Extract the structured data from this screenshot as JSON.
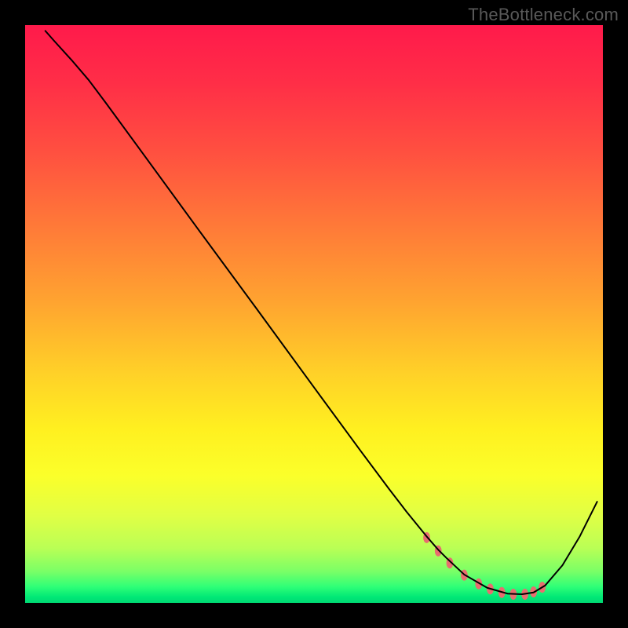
{
  "watermark": "TheBottleneck.com",
  "plot": {
    "inset_left": 32,
    "inset_top": 32,
    "inset_right": 32,
    "inset_bottom": 32,
    "gradient_stops": [
      {
        "pos": 0.0,
        "color": "#ff1a4b"
      },
      {
        "pos": 0.1,
        "color": "#ff2e47"
      },
      {
        "pos": 0.22,
        "color": "#ff5040"
      },
      {
        "pos": 0.35,
        "color": "#ff7a38"
      },
      {
        "pos": 0.48,
        "color": "#ffa430"
      },
      {
        "pos": 0.6,
        "color": "#ffd028"
      },
      {
        "pos": 0.7,
        "color": "#fff020"
      },
      {
        "pos": 0.78,
        "color": "#fbff2a"
      },
      {
        "pos": 0.85,
        "color": "#e0ff45"
      },
      {
        "pos": 0.905,
        "color": "#baff55"
      },
      {
        "pos": 0.945,
        "color": "#7bff66"
      },
      {
        "pos": 0.972,
        "color": "#2fff77"
      },
      {
        "pos": 0.99,
        "color": "#00e876"
      },
      {
        "pos": 1.0,
        "color": "#00d873"
      }
    ]
  },
  "chart_data": {
    "type": "line",
    "title": "",
    "xlabel": "",
    "ylabel": "",
    "xlim": [
      0,
      100
    ],
    "ylim": [
      0,
      100
    ],
    "series": [
      {
        "name": "curve",
        "stroke": "#000000",
        "stroke_width": 2.0,
        "x": [
          3.5,
          5.0,
          8.0,
          11.0,
          14.0,
          20.0,
          30.0,
          40.0,
          50.0,
          58.0,
          63.0,
          66.0,
          69.5,
          71.5,
          73.0,
          76.0,
          80.0,
          83.5,
          86.0,
          88.0,
          90.0,
          93.0,
          96.0,
          99.0
        ],
        "y": [
          99.0,
          97.3,
          94.0,
          90.5,
          86.5,
          78.3,
          64.6,
          51.0,
          37.3,
          26.4,
          19.7,
          15.8,
          11.5,
          9.2,
          7.7,
          4.9,
          2.6,
          1.6,
          1.5,
          1.8,
          3.0,
          6.5,
          11.5,
          17.5
        ]
      },
      {
        "name": "optimal-band-markers",
        "type": "scatter",
        "color": "#e86d6f",
        "marker_rx": 4.4,
        "marker_ry": 7.0,
        "x": [
          69.5,
          71.5,
          73.5,
          76.0,
          78.5,
          80.5,
          82.5,
          84.5,
          86.5,
          88.0,
          89.5
        ],
        "y": [
          11.3,
          9.0,
          6.9,
          4.8,
          3.3,
          2.4,
          1.8,
          1.5,
          1.5,
          1.9,
          2.7
        ]
      }
    ]
  }
}
